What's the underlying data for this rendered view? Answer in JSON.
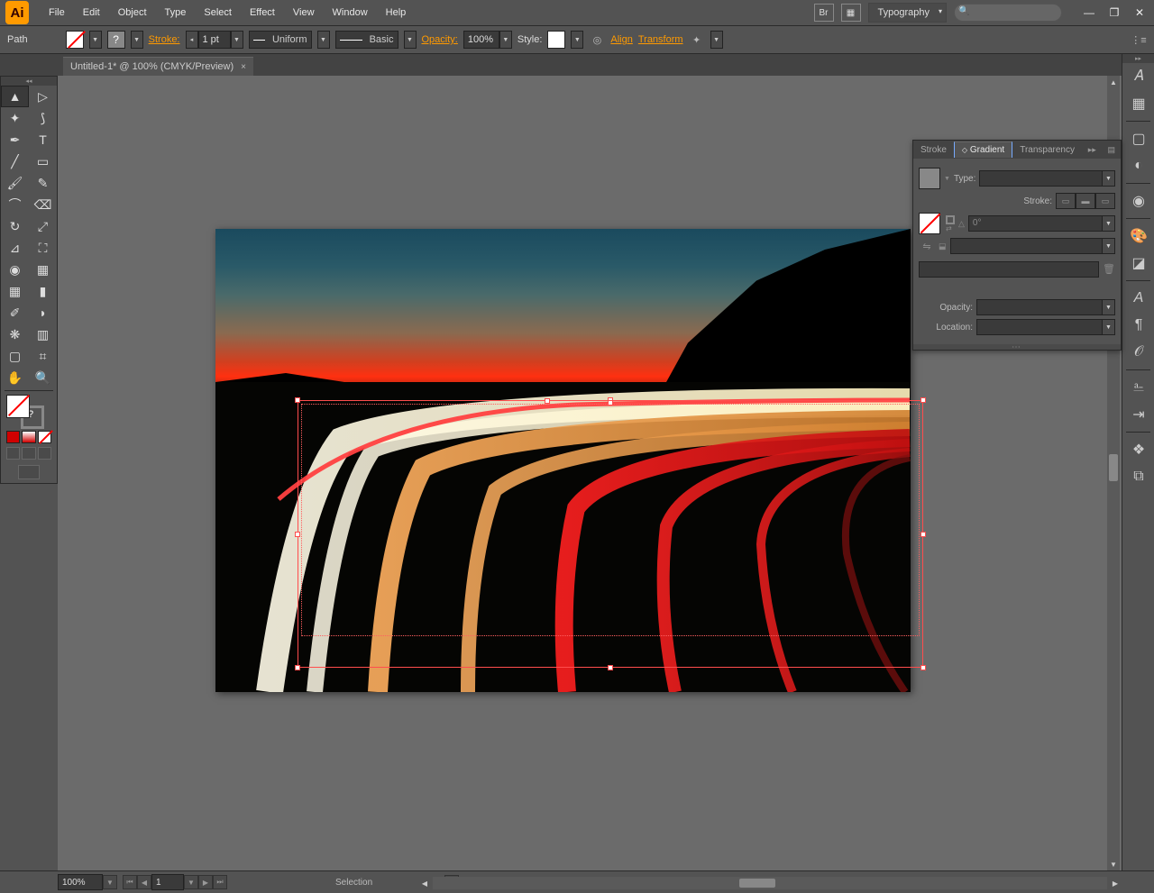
{
  "app": {
    "logo_text": "Ai"
  },
  "menubar": {
    "items": [
      "File",
      "Edit",
      "Object",
      "Type",
      "Select",
      "Effect",
      "View",
      "Window",
      "Help"
    ],
    "workspace": "Typography",
    "search_placeholder": ""
  },
  "controlbar": {
    "mode": "Path",
    "stroke_label": "Stroke:",
    "stroke_weight": "1 pt",
    "brush_uniform": "Uniform",
    "brush_basic": "Basic",
    "opacity_label": "Opacity:",
    "opacity_value": "100%",
    "style_label": "Style:",
    "align_label": "Align",
    "transform_label": "Transform"
  },
  "document": {
    "tab_title": "Untitled-1* @ 100% (CMYK/Preview)"
  },
  "gradient_panel": {
    "tabs": [
      "Stroke",
      "Gradient",
      "Transparency"
    ],
    "active_tab": 1,
    "type_label": "Type:",
    "stroke_label": "Stroke:",
    "angle_value": "0°",
    "opacity_label": "Opacity:",
    "location_label": "Location:"
  },
  "statusbar": {
    "zoom": "100%",
    "artboard_num": "1",
    "tool": "Selection"
  },
  "tools": {
    "left_col": [
      "selection",
      "magic-wand",
      "pen",
      "line",
      "brush",
      "shape-builder",
      "mesh",
      "eyedropper",
      "artboard",
      "hand"
    ],
    "right_col": [
      "direct-selection",
      "lasso",
      "type",
      "rectangle",
      "eraser",
      "perspective",
      "gradient",
      "column-graph",
      "slice",
      "zoom"
    ]
  },
  "right_strip_icons": [
    "character",
    "paragraph-styles",
    "color",
    "color-guide",
    "swatches",
    "brushes",
    "symbols",
    "stroke-panel",
    "gradient-panel",
    "transparency-panel",
    "appearance",
    "graphic-styles",
    "layers",
    "artboards"
  ]
}
